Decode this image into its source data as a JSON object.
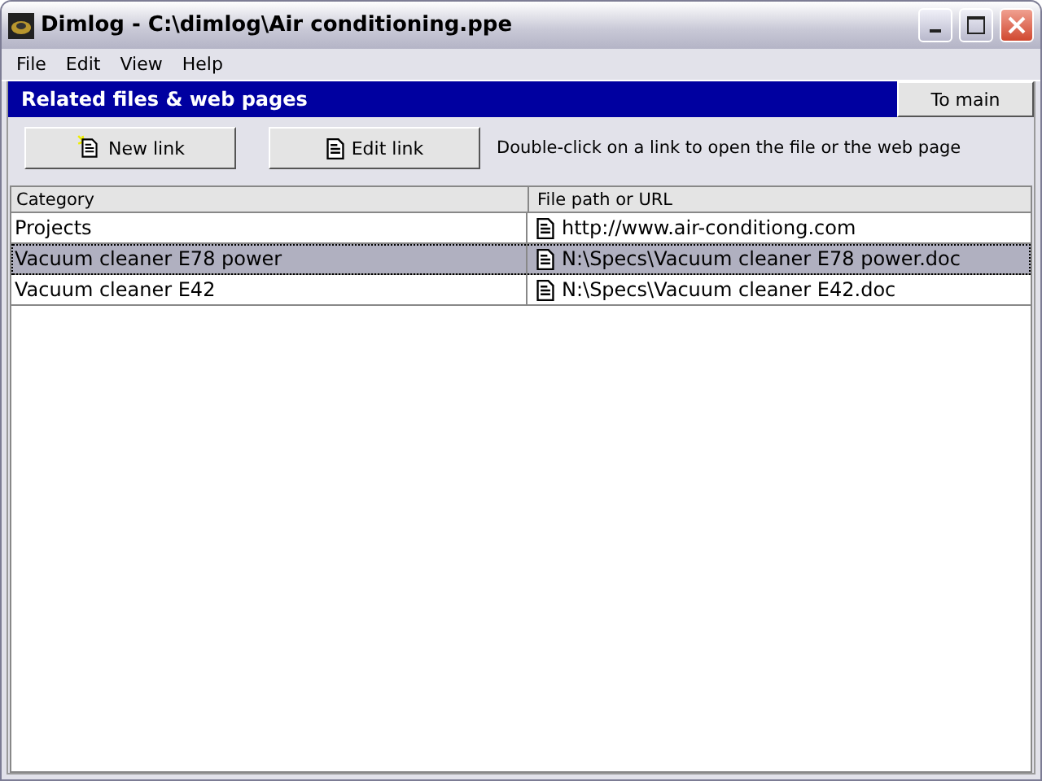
{
  "window": {
    "title": "Dimlog - C:\\dimlog\\Air conditioning.ppe"
  },
  "menu": [
    "File",
    "Edit",
    "View",
    "Help"
  ],
  "header": {
    "title": "Related files & web pages",
    "button": "To main"
  },
  "toolbar": {
    "buttons": [
      {
        "label": "New link",
        "kind": "new"
      },
      {
        "label": "Edit link",
        "kind": "edit"
      }
    ],
    "hint": "Double-click on a link to open the file or the web page"
  },
  "table": {
    "columns": [
      "Category",
      "File path or URL"
    ],
    "rows": [
      {
        "category": "Projects",
        "path": "http://www.air-conditiong.com",
        "selected": false
      },
      {
        "category": "Vacuum cleaner E78 power",
        "path": "N:\\Specs\\Vacuum cleaner E78 power.doc",
        "selected": true
      },
      {
        "category": "Vacuum cleaner E42",
        "path": "N:\\Specs\\Vacuum cleaner E42.doc",
        "selected": false
      }
    ]
  }
}
